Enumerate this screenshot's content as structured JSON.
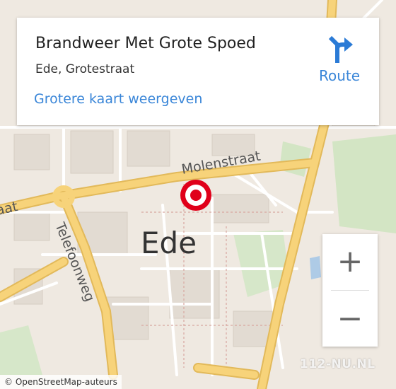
{
  "info_card": {
    "title": "Brandweer Met Grote Spoed",
    "address": "Ede, Grotestraat",
    "larger_map_link": "Grotere kaart weergeven",
    "route_label": "Route"
  },
  "map": {
    "city_label": "Ede",
    "street_labels": {
      "molenstraat": "Molenstraat",
      "telefoonweg": "Telefoonweg",
      "left_fragment": "aat"
    },
    "marker_icon": "target-marker-icon",
    "colors": {
      "major_road": "#f7d37a",
      "major_road_casing": "#e2b95a",
      "minor_road": "#ffffff",
      "land": "#efe9e1",
      "park": "#cfe3c2",
      "marker_red": "#e0001a"
    }
  },
  "controls": {
    "zoom_in_symbol": "+",
    "zoom_out_symbol": "−"
  },
  "attribution": {
    "text": "© OpenStreetMap-auteurs"
  },
  "watermark": "112-NU.NL"
}
